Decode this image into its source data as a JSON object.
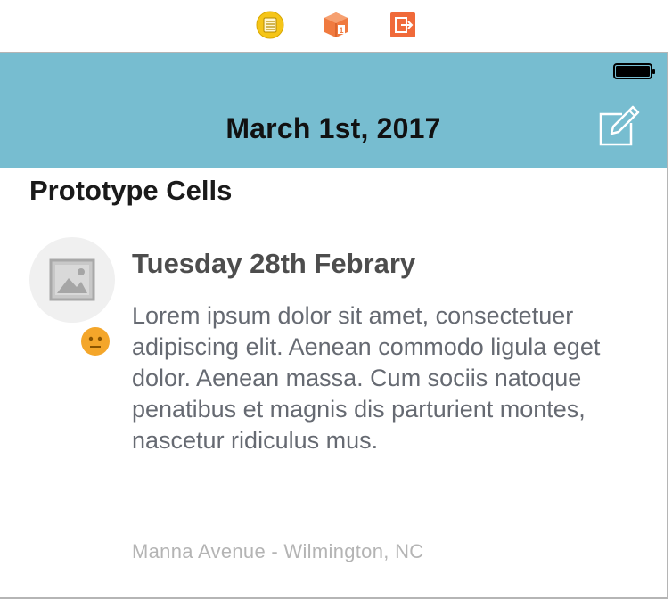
{
  "scene_dock": {
    "icons": [
      "view-controller-icon",
      "first-responder-icon",
      "exit-icon"
    ],
    "colors": {
      "view_controller": "#f5c518",
      "first_responder": "#f07a3f",
      "exit": "#f06a3a"
    }
  },
  "navbar": {
    "title": "March 1st, 2017",
    "background": "#77bdd0",
    "right_icon": "compose-icon"
  },
  "section": {
    "title": "Prototype Cells"
  },
  "cell": {
    "avatar_icon": "image-placeholder-icon",
    "mood_icon": "neutral-face-icon",
    "title": "Tuesday 28th Febrary",
    "body": "Lorem ipsum dolor sit amet, consectetuer adipiscing elit. Aenean commodo ligula eget dolor. Aenean massa. Cum sociis natoque penatibus et magnis dis parturient montes, nascetur ridiculus mus.",
    "location": "Manna Avenue - Wilmington, NC"
  }
}
